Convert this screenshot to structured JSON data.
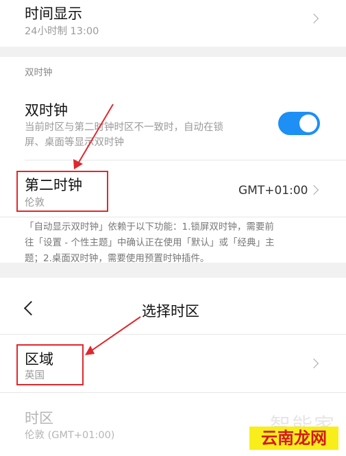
{
  "time_display": {
    "title": "时间显示",
    "subtitle": "24小时制 13:00"
  },
  "dual_clock_section": {
    "header": "双时钟",
    "toggle_item": {
      "title": "双时钟",
      "description_line1": "当前时区与第二时钟时区不一致时，自动在锁",
      "description_line2": "屏、桌面等显示双时钟",
      "enabled": true
    },
    "second_clock": {
      "title": "第二时钟",
      "subtitle": "伦敦",
      "value": "GMT+01:00"
    },
    "note": {
      "line1": "「自动显示双时钟」依赖于以下功能：1.锁屏双时钟，需要前",
      "line2": "往「设置 - 个性主题」中确认正在使用「默认」或「经典」主",
      "line3": "题；2.桌面双时钟，需要使用预置时钟插件。"
    }
  },
  "timezone_screen": {
    "title": "选择时区",
    "region": {
      "title": "区域",
      "subtitle": "英国"
    },
    "timezone": {
      "title": "时区",
      "subtitle": "伦敦 (GMT+01:00)"
    }
  },
  "watermark": {
    "text": "智能家",
    "brand": "云南龙网"
  },
  "colors": {
    "accent": "#1d8ff5",
    "annotation_red": "#e0272d",
    "brand_bg": "#f8ee1c"
  },
  "icons": [
    "chevron-right-icon",
    "back-arrow-icon"
  ]
}
